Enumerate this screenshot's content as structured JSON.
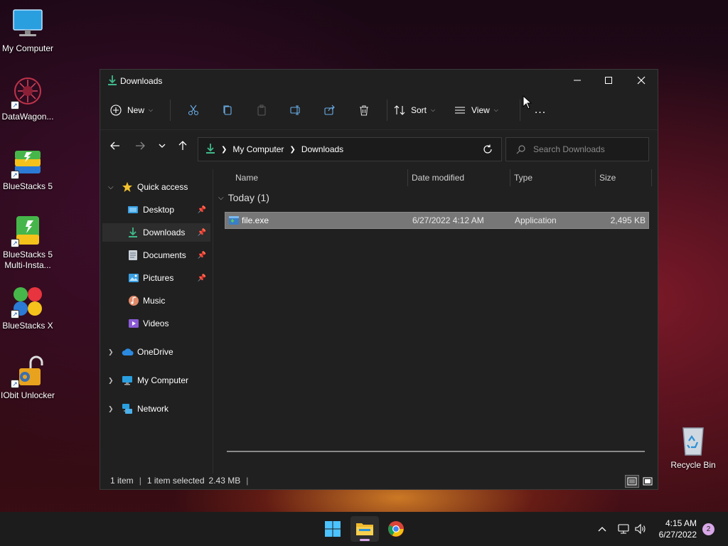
{
  "desktop": {
    "icons": [
      {
        "label": "My Computer"
      },
      {
        "label": "DataWagon..."
      },
      {
        "label": "BlueStacks 5"
      },
      {
        "label": "BlueStacks 5 Multi-Insta..."
      },
      {
        "label": "BlueStacks X"
      },
      {
        "label": "IObit Unlocker"
      },
      {
        "label": "Recycle Bin"
      }
    ]
  },
  "window": {
    "title": "Downloads",
    "toolbar": {
      "new_label": "New",
      "sort_label": "Sort",
      "view_label": "View",
      "more_label": "..."
    },
    "address": {
      "crumbs": [
        "My Computer",
        "Downloads"
      ]
    },
    "search": {
      "placeholder": "Search Downloads"
    },
    "nav": {
      "quick_access": "Quick access",
      "items": [
        {
          "label": "Desktop"
        },
        {
          "label": "Downloads"
        },
        {
          "label": "Documents"
        },
        {
          "label": "Pictures"
        },
        {
          "label": "Music"
        },
        {
          "label": "Videos"
        }
      ],
      "onedrive": "OneDrive",
      "my_computer": "My Computer",
      "network": "Network"
    },
    "columns": {
      "name": "Name",
      "date": "Date modified",
      "type": "Type",
      "size": "Size"
    },
    "group": {
      "label": "Today (1)"
    },
    "files": [
      {
        "name": "file.exe",
        "date": "6/27/2022 4:12 AM",
        "type": "Application",
        "size": "2,495 KB"
      }
    ],
    "status": {
      "count": "1 item",
      "selected": "1 item selected",
      "size": "2.43 MB"
    }
  },
  "taskbar": {
    "time": "4:15 AM",
    "date": "6/27/2022",
    "notifications": "2"
  }
}
